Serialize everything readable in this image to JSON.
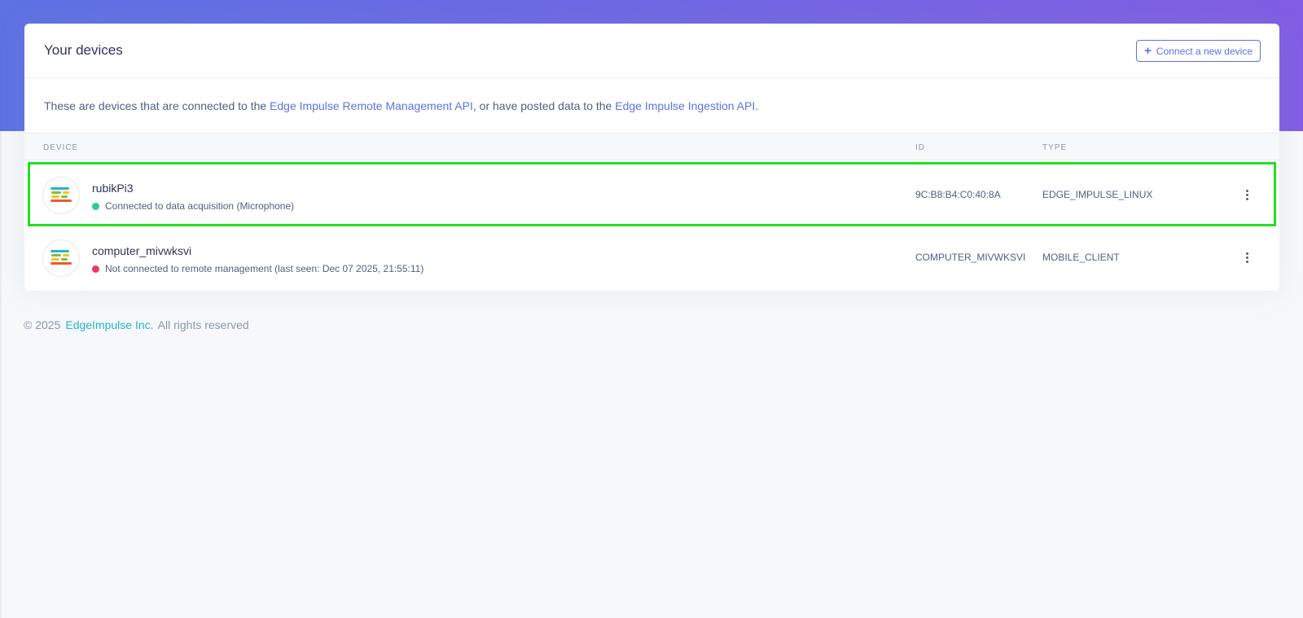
{
  "card": {
    "title": "Your devices",
    "connect_label": "Connect a new device",
    "description": {
      "prefix": "These are devices that are connected to the ",
      "link1": "Edge Impulse Remote Management API",
      "middle": ", or have posted data to the ",
      "link2": "Edge Impulse Ingestion API",
      "suffix": "."
    }
  },
  "table": {
    "headers": {
      "device": "DEVICE",
      "id": "ID",
      "type": "TYPE"
    },
    "rows": [
      {
        "name": "rubikPi3",
        "status": "Connected to data acquisition (Microphone)",
        "status_color": "#2dce89",
        "id": "9C:B8:B4:C0:40:8A",
        "type": "EDGE_IMPULSE_LINUX"
      },
      {
        "name": "computer_mivwksvi",
        "status": "Not connected to remote management (last seen: Dec 07 2025, 21:55:11)",
        "status_color": "#f5365c",
        "id": "COMPUTER_MIVWKSVI",
        "type": "MOBILE_CLIENT"
      }
    ]
  },
  "footer": {
    "copyright": "© 2025",
    "company": "EdgeImpulse Inc.",
    "rights": "All rights reserved"
  },
  "icons": {
    "device": "edge-impulse-logo-icon",
    "menu": "kebab-menu-icon",
    "plus": "plus-icon"
  },
  "colors": {
    "accent": "#5e72e4",
    "highlight": "#22e022",
    "connected": "#2dce89",
    "disconnected": "#f5365c"
  }
}
